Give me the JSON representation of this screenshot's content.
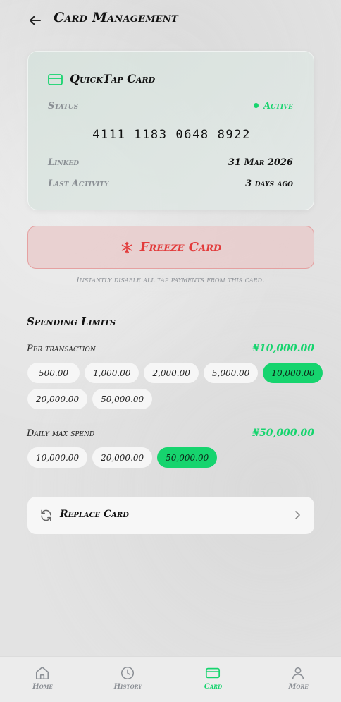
{
  "header": {
    "title": "Card Management",
    "back_icon": "arrow-left-icon"
  },
  "card": {
    "icon": "credit-card-icon",
    "name": "QuickTap Card",
    "status_label": "Status",
    "status_value": "Active",
    "number": "4111 1183 0648 8922",
    "linked_label": "Linked",
    "linked_value": "31 Mar 2026",
    "activity_label": "Last Activity",
    "activity_value": "3 days ago"
  },
  "freeze": {
    "icon": "snowflake-icon",
    "label": "Freeze Card",
    "hint": "Instantly disable all tap payments from this card."
  },
  "limits": {
    "title": "Spending Limits",
    "per_transaction": {
      "label": "Per transaction",
      "value": "₦10,000.00",
      "options": [
        "500.00",
        "1,000.00",
        "2,000.00",
        "5,000.00",
        "10,000.00",
        "20,000.00",
        "50,000.00"
      ],
      "selected": "10,000.00"
    },
    "daily_max": {
      "label": "Daily max spend",
      "value": "₦50,000.00",
      "options": [
        "10,000.00",
        "20,000.00",
        "50,000.00"
      ],
      "selected": "50,000.00"
    }
  },
  "replace": {
    "icon": "refresh-icon",
    "label": "Replace Card",
    "chevron_icon": "chevron-right-icon"
  },
  "nav": {
    "items": [
      {
        "label": "Home",
        "icon": "home-icon"
      },
      {
        "label": "History",
        "icon": "clock-icon"
      },
      {
        "label": "Card",
        "icon": "credit-card-icon"
      },
      {
        "label": "More",
        "icon": "user-icon"
      }
    ],
    "active": "Card"
  },
  "colors": {
    "accent": "#16d46e",
    "danger": "#e23b3b",
    "muted": "#8c9096"
  }
}
